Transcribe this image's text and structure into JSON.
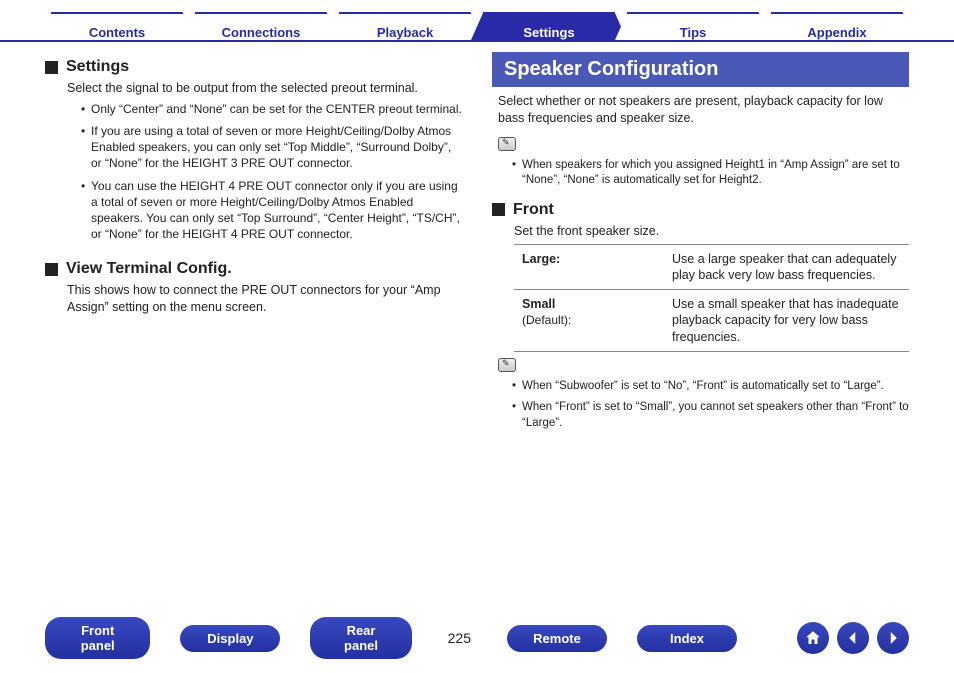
{
  "tabs": {
    "contents": "Contents",
    "connections": "Connections",
    "playback": "Playback",
    "settings": "Settings",
    "tips": "Tips",
    "appendix": "Appendix"
  },
  "left": {
    "settings_heading": "Settings",
    "settings_intro": "Select the signal to be output from the selected preout terminal.",
    "settings_bullets": [
      "Only “Center” and “None” can be set for the CENTER preout terminal.",
      "If you are using a total of seven or more Height/Ceiling/Dolby Atmos Enabled speakers, you can only set “Top Middle”, “Surround Dolby”, or “None” for the HEIGHT 3 PRE OUT connector.",
      "You can use the HEIGHT 4 PRE OUT connector only if you are using a total of seven or more Height/Ceiling/Dolby Atmos Enabled speakers. You can only set “Top Surround”, “Center Height”, “TS/CH”, or “None” for the HEIGHT 4 PRE OUT connector."
    ],
    "view_terminal_heading": "View Terminal Config.",
    "view_terminal_text": "This shows how to connect the PRE OUT connectors for your “Amp Assign” setting on the menu screen."
  },
  "right": {
    "section_title": "Speaker Configuration",
    "intro": "Select whether or not speakers are present, playback capacity for low bass frequencies and speaker size.",
    "note1": [
      "When speakers for which you assigned Height1 in “Amp Assign” are set to “None”, “None” is automatically set for Height2."
    ],
    "front_heading": "Front",
    "front_intro": "Set the front speaker size.",
    "options": [
      {
        "label": "Large:",
        "default": "",
        "desc": "Use a large speaker that can adequately play back very low bass frequencies."
      },
      {
        "label": "Small",
        "default": "(Default):",
        "desc": "Use a small speaker that has inadequate playback capacity for very low bass frequencies."
      }
    ],
    "note2": [
      "When “Subwoofer” is set to “No”, “Front” is automatically set to “Large”.",
      "When “Front” is set to “Small”, you cannot set speakers other than “Front” to “Large”."
    ]
  },
  "footer": {
    "front_panel": "Front panel",
    "display": "Display",
    "rear_panel": "Rear panel",
    "page": "225",
    "remote": "Remote",
    "index": "Index"
  }
}
